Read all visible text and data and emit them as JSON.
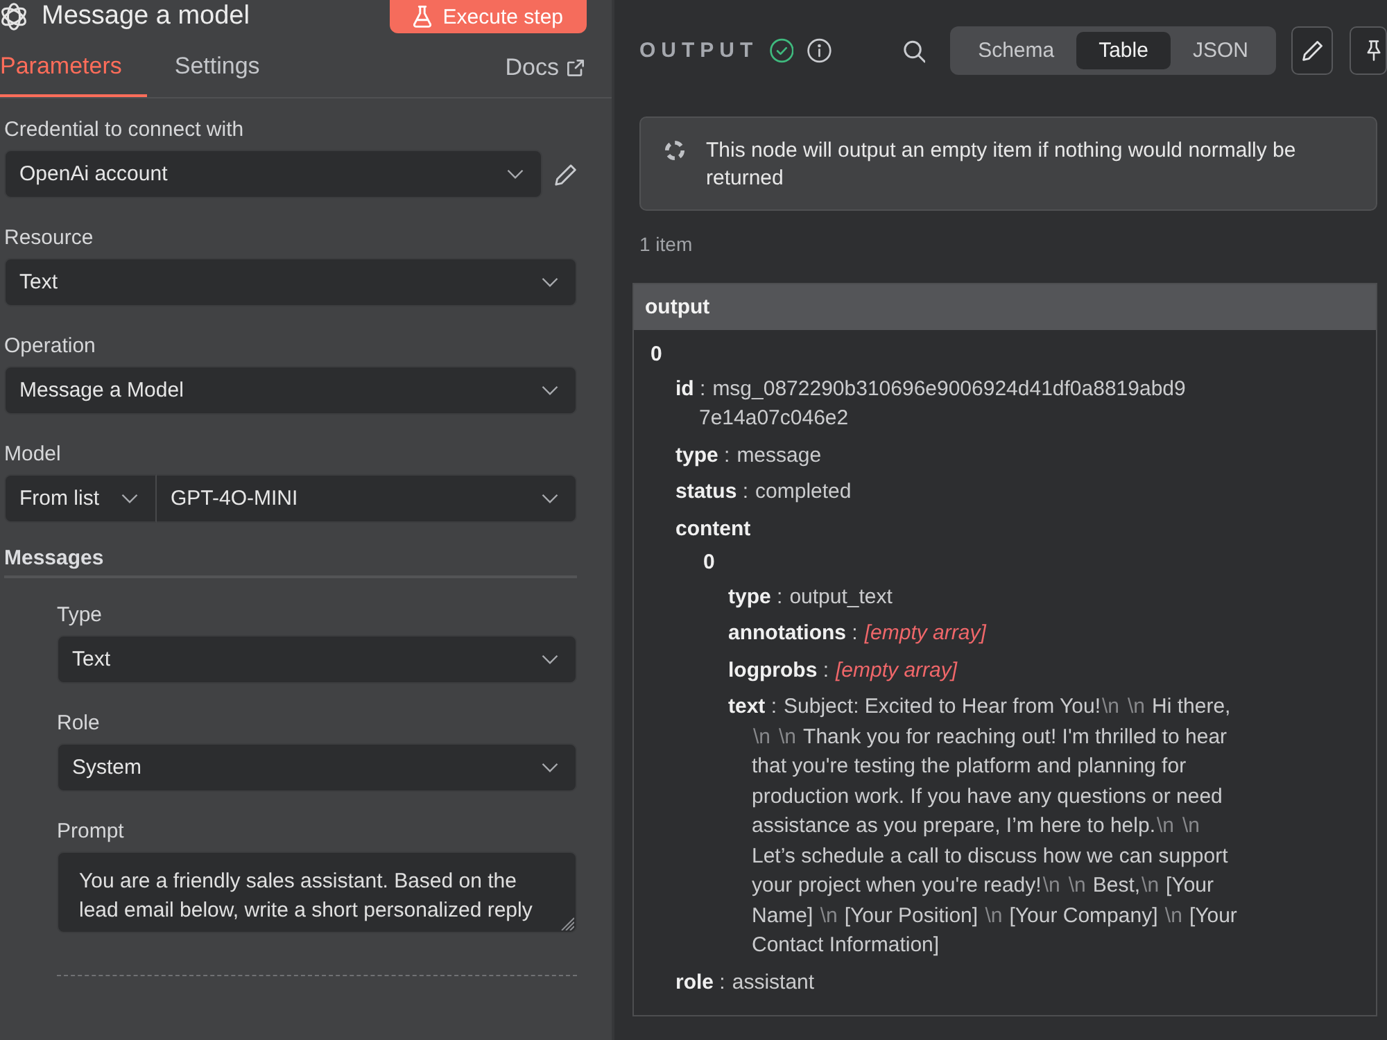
{
  "node": {
    "title": "Message a model",
    "execute_label": "Execute step"
  },
  "tabs": [
    {
      "label": "Parameters",
      "selected": true
    },
    {
      "label": "Settings",
      "selected": false
    }
  ],
  "docs_link": "Docs",
  "parameters": [
    {
      "kind": "credential",
      "label": "Credential to connect with",
      "value": "OpenAi account"
    },
    {
      "kind": "select",
      "label": "Resource",
      "value": "Text"
    },
    {
      "kind": "select",
      "label": "Operation",
      "value": "Message a Model"
    },
    {
      "kind": "split",
      "label": "Model",
      "mode": "From list",
      "value": "GPT-4O-MINI"
    },
    {
      "kind": "collection",
      "label": "Messages",
      "children": [
        {
          "kind": "select",
          "label": "Type",
          "value": "Text"
        },
        {
          "kind": "select",
          "label": "Role",
          "value": "System"
        },
        {
          "kind": "textarea",
          "label": "Prompt",
          "value": "You are a friendly sales assistant. Based on the lead email below, write a short personalized reply"
        }
      ]
    }
  ],
  "output": {
    "title": "OUTPUT",
    "views": [
      {
        "label": "Schema",
        "selected": false
      },
      {
        "label": "Table",
        "selected": true
      },
      {
        "label": "JSON",
        "selected": false
      }
    ],
    "notice": "This node will output an empty item if nothing would normally be returned",
    "item_count": "1 item",
    "table": {
      "header": "output",
      "items": [
        {
          "index": "0",
          "fields": [
            {
              "label": "**id** :",
              "value": [
                {
                  "kind": "token",
                  "text": "msg_0872290b310696e9006924d41df0a8819abd97e14a07c046e2"
                }
              ]
            },
            {
              "label": "**type** :",
              "value": [
                {
                  "kind": "text",
                  "text": "message"
                }
              ]
            },
            {
              "label": "**status** :",
              "value": [
                {
                  "kind": "text",
                  "text": "completed"
                }
              ]
            },
            {
              "label": "content",
              "children": [
                {
                  "index": "0",
                  "fields": [
                    {
                      "label": "**type** :",
                      "value": [
                        {
                          "kind": "text",
                          "text": "output_text"
                        }
                      ]
                    },
                    {
                      "label": "**annotations** :",
                      "value": [
                        {
                          "kind": "empty",
                          "text": "[empty array]"
                        }
                      ]
                    },
                    {
                      "label": "**logprobs** :",
                      "value": [
                        {
                          "kind": "empty",
                          "text": "[empty array]"
                        }
                      ]
                    },
                    {
                      "label": "**text** :",
                      "value": [
                        {
                          "kind": "text",
                          "text": "Subject: Excited to Hear from You!"
                        },
                        {
                          "kind": "escape",
                          "text": "\\n"
                        },
                        {
                          "kind": "escape",
                          "text": "\\n"
                        },
                        {
                          "kind": "text",
                          "text": "Hi there,"
                        },
                        {
                          "kind": "escape",
                          "text": "\\n"
                        },
                        {
                          "kind": "escape",
                          "text": "\\n"
                        },
                        {
                          "kind": "text",
                          "text": "Thank you for reaching out! I'm thrilled to hear that you're testing the platform and planning for production work. If you have any questions or need assistance as you prepare, I’m here to help."
                        },
                        {
                          "kind": "escape",
                          "text": "\\n"
                        },
                        {
                          "kind": "escape",
                          "text": "\\n"
                        },
                        {
                          "kind": "text",
                          "text": "Let’s schedule a call to discuss how we can support your project when you're ready!"
                        },
                        {
                          "kind": "escape",
                          "text": "\\n"
                        },
                        {
                          "kind": "escape",
                          "text": "\\n"
                        },
                        {
                          "kind": "text",
                          "text": "Best,"
                        },
                        {
                          "kind": "escape",
                          "text": "\\n"
                        },
                        {
                          "kind": "text",
                          "text": "[Your Name] "
                        },
                        {
                          "kind": "escape",
                          "text": "\\n"
                        },
                        {
                          "kind": "text",
                          "text": "[Your Position] "
                        },
                        {
                          "kind": "escape",
                          "text": "\\n"
                        },
                        {
                          "kind": "text",
                          "text": "[Your Company] "
                        },
                        {
                          "kind": "escape",
                          "text": "\\n"
                        },
                        {
                          "kind": "text",
                          "text": "[Your Contact Information]"
                        }
                      ]
                    }
                  ]
                }
              ]
            },
            {
              "label": "**role** :",
              "value": [
                {
                  "kind": "text",
                  "text": "assistant"
                }
              ]
            }
          ]
        }
      ]
    }
  }
}
